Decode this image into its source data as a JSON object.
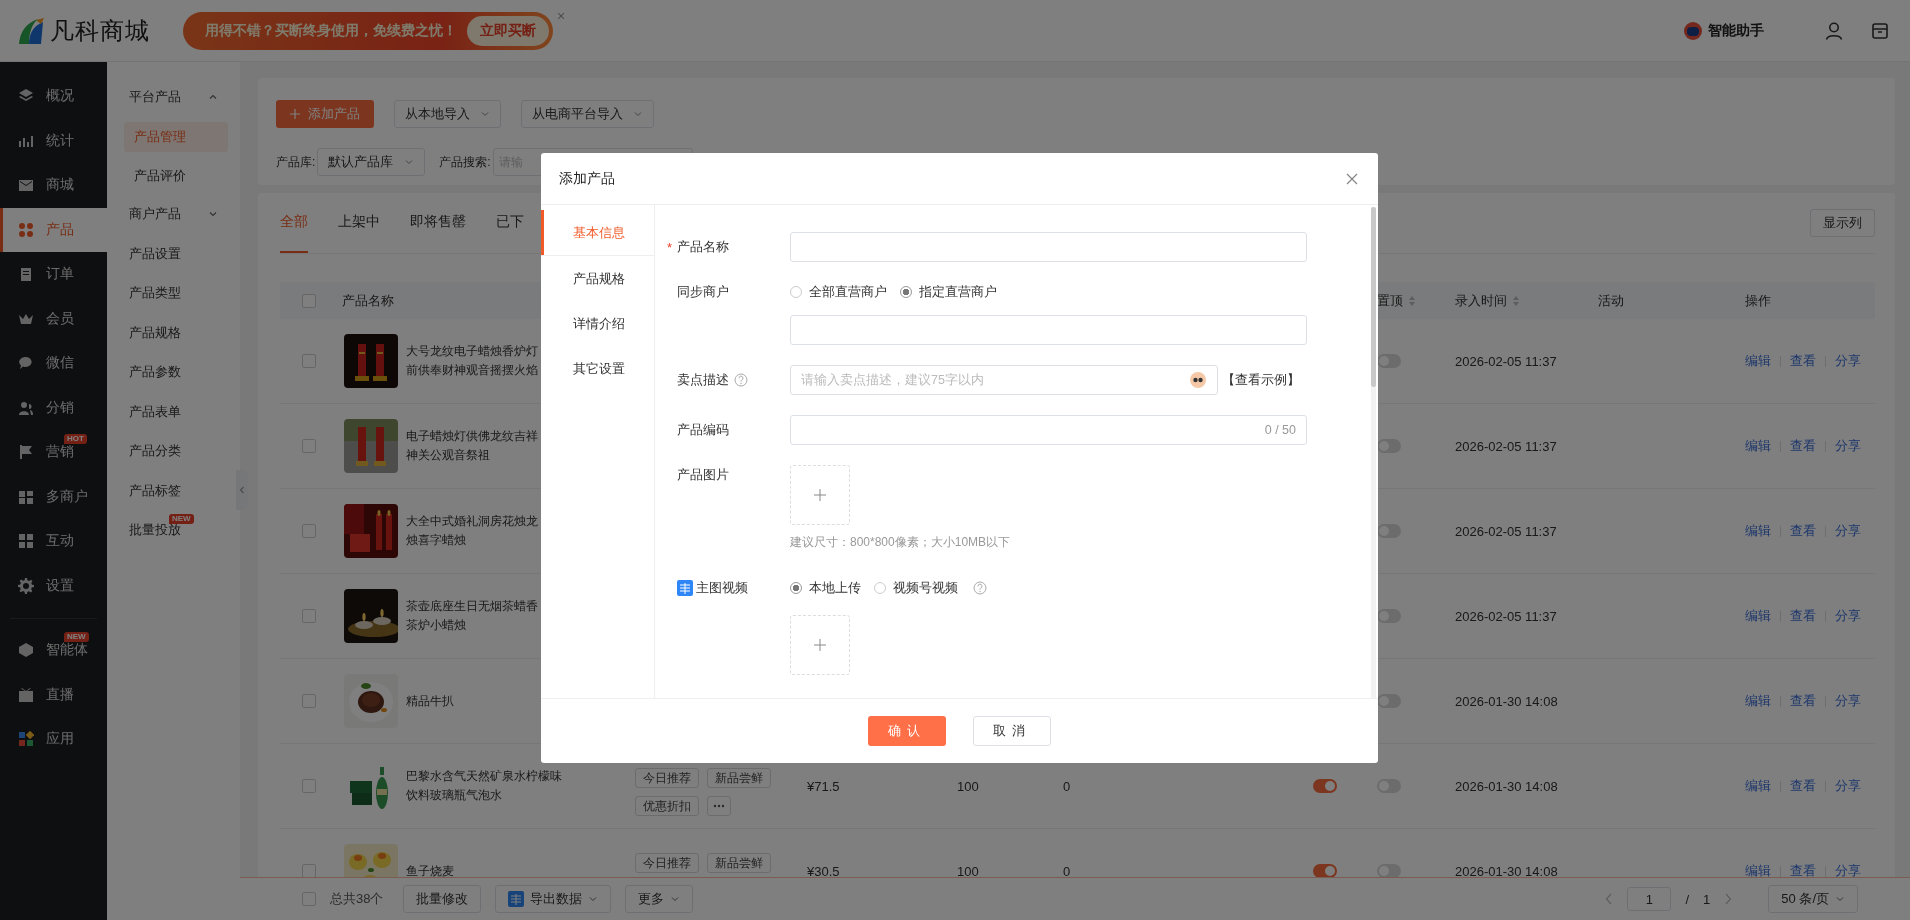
{
  "header": {
    "logo": "凡科商城",
    "promo": {
      "text": "用得不错？买断终身使用，免续费之忧！",
      "button": "立即买断",
      "close": "×"
    },
    "assistant": "智能助手"
  },
  "nav": {
    "main": [
      {
        "label": "概况",
        "selected": false
      },
      {
        "label": "统计",
        "selected": false
      },
      {
        "label": "商城",
        "selected": false
      },
      {
        "label": "产品",
        "selected": true
      },
      {
        "label": "订单",
        "selected": false
      },
      {
        "label": "会员",
        "selected": false
      },
      {
        "label": "微信",
        "selected": false
      },
      {
        "label": "分销",
        "selected": false
      },
      {
        "label": "营销",
        "selected": false,
        "badge": "HOT"
      },
      {
        "label": "多商户",
        "selected": false
      },
      {
        "label": "互动",
        "selected": false
      },
      {
        "label": "设置",
        "selected": false
      }
    ],
    "extra": [
      {
        "label": "智能体",
        "selected": false,
        "badge": "NEW"
      },
      {
        "label": "直播",
        "selected": false
      },
      {
        "label": "应用",
        "selected": false
      }
    ]
  },
  "subnav": [
    {
      "kind": "group",
      "label": "平台产品",
      "expanded": true,
      "children": [
        {
          "label": "产品管理",
          "selected": true
        },
        {
          "label": "产品评价",
          "selected": false
        }
      ]
    },
    {
      "kind": "group",
      "label": "商户产品",
      "expanded": false
    },
    {
      "kind": "item",
      "label": "产品设置",
      "selected": false
    },
    {
      "kind": "item",
      "label": "产品类型",
      "selected": false
    },
    {
      "kind": "item",
      "label": "产品规格",
      "selected": false
    },
    {
      "kind": "item",
      "label": "产品参数",
      "selected": false
    },
    {
      "kind": "item",
      "label": "产品表单",
      "selected": false
    },
    {
      "kind": "item",
      "label": "产品分类",
      "selected": false
    },
    {
      "kind": "item",
      "label": "产品标签",
      "selected": false
    },
    {
      "kind": "item",
      "label": "批量投放",
      "selected": false,
      "badge": "NEW"
    }
  ],
  "toolbar": {
    "add": "添加产品",
    "imports": [
      "从本地导入",
      "从电商平台导入"
    ],
    "filters": [
      {
        "kind": "select",
        "label": "产品库:",
        "value": "默认产品库"
      },
      {
        "kind": "input",
        "label": "产品搜索:",
        "placeholder": "请输"
      }
    ]
  },
  "tabs": [
    {
      "label": "全部",
      "selected": true
    },
    {
      "label": "上架中",
      "selected": false
    },
    {
      "label": "即将售罄",
      "selected": false
    },
    {
      "label": "已下",
      "selected": false
    }
  ],
  "columns_button": "显示列",
  "table": {
    "header_checked": false,
    "columns": [
      {
        "label": "产品名称",
        "sortable": false
      },
      {
        "label": "置顶",
        "sortable": true
      },
      {
        "label": "录入时间",
        "sortable": true
      },
      {
        "label": "活动",
        "sortable": false
      },
      {
        "label": "操作",
        "sortable": false
      }
    ],
    "rows": [
      {
        "checked": false,
        "name_lines": [
          "大号龙纹电子蜡烛香炉灯",
          "前供奉财神观音摇摆火焰"
        ],
        "pinned": false,
        "created": "2026-02-05 11:37",
        "actions": [
          "编辑",
          "查看",
          "分享"
        ]
      },
      {
        "checked": false,
        "name_lines": [
          "电子蜡烛灯供佛龙纹吉祥",
          "神关公观音祭祖"
        ],
        "pinned": false,
        "created": "2026-02-05 11:37",
        "actions": [
          "编辑",
          "查看",
          "分享"
        ]
      },
      {
        "checked": false,
        "name_lines": [
          "大全中式婚礼洞房花烛龙",
          "烛喜字蜡烛"
        ],
        "pinned": false,
        "created": "2026-02-05 11:37",
        "actions": [
          "编辑",
          "查看",
          "分享"
        ]
      },
      {
        "checked": false,
        "name_lines": [
          "茶壶底座生日无烟茶蜡香",
          "茶炉小蜡烛"
        ],
        "pinned": false,
        "created": "2026-02-05 11:37",
        "actions": [
          "编辑",
          "查看",
          "分享"
        ]
      },
      {
        "checked": false,
        "name_lines": [
          "精品牛扒"
        ],
        "pinned": false,
        "created": "2026-01-30 14:08",
        "actions": [
          "编辑",
          "查看",
          "分享"
        ]
      },
      {
        "checked": false,
        "name_lines": [
          "巴黎水含气天然矿泉水柠檬味",
          "饮料玻璃瓶气泡水"
        ],
        "tags": [
          "今日推荐",
          "新品尝鲜",
          "优惠折扣"
        ],
        "more_tags": true,
        "price": "¥71.5",
        "stock": "100",
        "sales": "0",
        "on_sale": true,
        "pinned": false,
        "created": "2026-01-30 14:08",
        "actions": [
          "编辑",
          "查看",
          "分享"
        ]
      },
      {
        "checked": false,
        "name_lines": [
          "鱼子烧麦"
        ],
        "tags": [
          "今日推荐",
          "新品尝鲜"
        ],
        "more_tags": false,
        "price": "¥30.5",
        "stock": "100",
        "sales": "0",
        "on_sale": true,
        "pinned": false,
        "created": "2026-01-30 14:08",
        "actions": [
          "编辑",
          "查看",
          "分享"
        ]
      }
    ]
  },
  "footer": {
    "checked": false,
    "total": "总共38个",
    "buttons": [
      {
        "kind": "plain",
        "label": "批量修改"
      },
      {
        "kind": "export",
        "label": "导出数据"
      },
      {
        "kind": "dropdown",
        "label": "更多"
      }
    ],
    "pagination": {
      "page": "1",
      "separator": "/",
      "pages": "1",
      "size": "50 条/页"
    }
  },
  "modal": {
    "title": "添加产品",
    "tabs": [
      {
        "label": "基本信息",
        "selected": true
      },
      {
        "label": "产品规格",
        "selected": false
      },
      {
        "label": "详情介绍",
        "selected": false
      },
      {
        "label": "其它设置",
        "selected": false
      }
    ],
    "fields": [
      {
        "kind": "text",
        "label": "产品名称",
        "required_mark": "*"
      },
      {
        "kind": "radio",
        "label": "同步商户",
        "options": [
          {
            "label": "全部直营商户",
            "selected": false
          },
          {
            "label": "指定直营商户",
            "selected": true
          }
        ],
        "with_input": true
      },
      {
        "kind": "text",
        "label": "卖点描述",
        "help": true,
        "placeholder": "请输入卖点描述，建议75字以内",
        "ai": true,
        "link": "【查看示例】"
      },
      {
        "kind": "text",
        "label": "产品编码",
        "counter": "0 / 50"
      },
      {
        "kind": "upload",
        "label": "产品图片",
        "hint": "建议尺寸：800*800像素；大小10MB以下"
      },
      {
        "kind": "radio",
        "label": "主图视频",
        "label_icon": true,
        "help": true,
        "options": [
          {
            "label": "本地上传",
            "selected": true
          },
          {
            "label": "视频号视频",
            "selected": false
          }
        ],
        "with_upload": true
      }
    ],
    "confirm": "确认",
    "cancel": "取消"
  }
}
